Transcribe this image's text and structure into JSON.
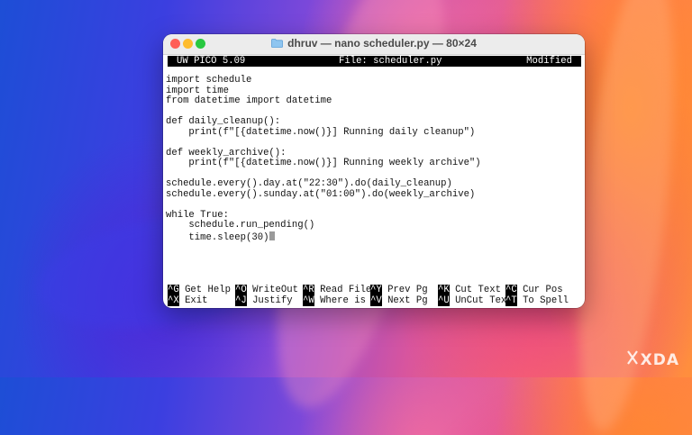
{
  "window": {
    "title": "dhruv — nano scheduler.py — 80×24"
  },
  "editor": {
    "app_version": "UW PICO 5.09",
    "file_label": "File: scheduler.py",
    "status": "Modified",
    "lines": [
      "import schedule",
      "import time",
      "from datetime import datetime",
      "",
      "def daily_cleanup():",
      "    print(f\"[{datetime.now()}] Running daily cleanup\")",
      "",
      "def weekly_archive():",
      "    print(f\"[{datetime.now()}] Running weekly archive\")",
      "",
      "schedule.every().day.at(\"22:30\").do(daily_cleanup)",
      "schedule.every().sunday.at(\"01:00\").do(weekly_archive)",
      "",
      "while True:",
      "    schedule.run_pending()",
      "    time.sleep(30)"
    ]
  },
  "shortcuts": {
    "row1": [
      {
        "key": "^G",
        "label": " Get Help"
      },
      {
        "key": "^O",
        "label": " WriteOut"
      },
      {
        "key": "^R",
        "label": " Read File"
      },
      {
        "key": "^Y",
        "label": " Prev Pg"
      },
      {
        "key": "^K",
        "label": " Cut Text"
      },
      {
        "key": "^C",
        "label": " Cur Pos"
      }
    ],
    "row2": [
      {
        "key": "^X",
        "label": " Exit"
      },
      {
        "key": "^J",
        "label": " Justify"
      },
      {
        "key": "^W",
        "label": " Where is"
      },
      {
        "key": "^V",
        "label": " Next Pg"
      },
      {
        "key": "^U",
        "label": " UnCut Text"
      },
      {
        "key": "^T",
        "label": " To Spell"
      }
    ]
  },
  "watermark": {
    "text": "XDA"
  },
  "colors": {
    "traffic_red": "#ff5f57",
    "traffic_yellow": "#febc2e",
    "traffic_green": "#28c840",
    "header_bg": "#000000"
  }
}
